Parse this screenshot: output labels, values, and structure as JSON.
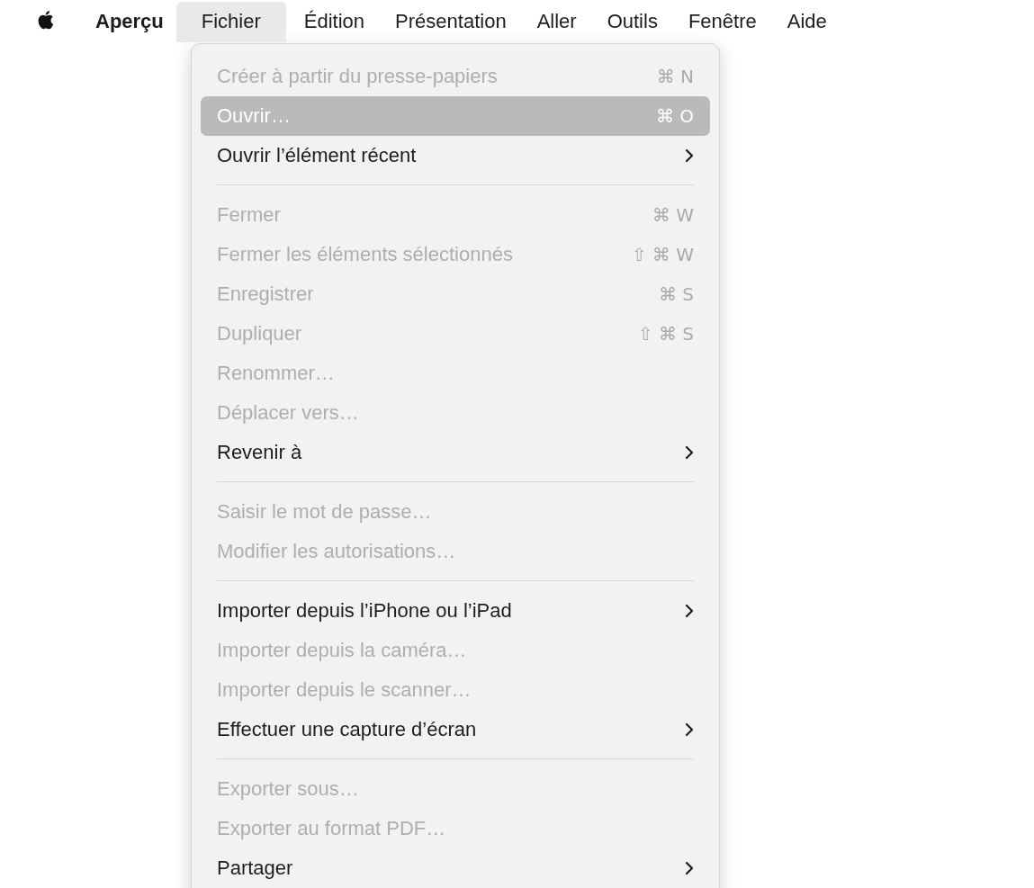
{
  "menu_bar": {
    "app_name": "Aperçu",
    "menus": [
      {
        "label": "Fichier",
        "selected": true
      },
      {
        "label": "Édition",
        "selected": false
      },
      {
        "label": "Présentation",
        "selected": false
      },
      {
        "label": "Aller",
        "selected": false
      },
      {
        "label": "Outils",
        "selected": false
      },
      {
        "label": "Fenêtre",
        "selected": false
      },
      {
        "label": "Aide",
        "selected": false
      }
    ]
  },
  "menu": {
    "items": [
      {
        "kind": "item",
        "label": "Créer à partir du presse-papiers",
        "shortcut": "⌘ N",
        "disabled": true,
        "selected": false,
        "submenu": false
      },
      {
        "kind": "item",
        "label": "Ouvrir…",
        "shortcut": "⌘ O",
        "disabled": false,
        "selected": true,
        "submenu": false
      },
      {
        "kind": "item",
        "label": "Ouvrir l’élément récent",
        "disabled": false,
        "selected": false,
        "submenu": true
      },
      {
        "kind": "separator"
      },
      {
        "kind": "item",
        "label": "Fermer",
        "shortcut": "⌘ W",
        "disabled": true,
        "selected": false,
        "submenu": false
      },
      {
        "kind": "item",
        "label": "Fermer les éléments sélectionnés",
        "shortcut": "⇧ ⌘ W",
        "disabled": true,
        "selected": false,
        "submenu": false
      },
      {
        "kind": "item",
        "label": "Enregistrer",
        "shortcut": "⌘ S",
        "disabled": true,
        "selected": false,
        "submenu": false
      },
      {
        "kind": "item",
        "label": "Dupliquer",
        "shortcut": "⇧ ⌘ S",
        "disabled": true,
        "selected": false,
        "submenu": false
      },
      {
        "kind": "item",
        "label": "Renommer…",
        "disabled": true,
        "selected": false,
        "submenu": false
      },
      {
        "kind": "item",
        "label": "Déplacer vers…",
        "disabled": true,
        "selected": false,
        "submenu": false
      },
      {
        "kind": "item",
        "label": "Revenir à",
        "disabled": false,
        "selected": false,
        "submenu": true
      },
      {
        "kind": "separator"
      },
      {
        "kind": "item",
        "label": "Saisir le mot de passe…",
        "disabled": true,
        "selected": false,
        "submenu": false
      },
      {
        "kind": "item",
        "label": "Modifier les autorisations…",
        "disabled": true,
        "selected": false,
        "submenu": false
      },
      {
        "kind": "separator"
      },
      {
        "kind": "item",
        "label": "Importer depuis l’iPhone ou l’iPad",
        "disabled": false,
        "selected": false,
        "submenu": true
      },
      {
        "kind": "item",
        "label": "Importer depuis la caméra…",
        "disabled": true,
        "selected": false,
        "submenu": false
      },
      {
        "kind": "item",
        "label": "Importer depuis le scanner…",
        "disabled": true,
        "selected": false,
        "submenu": false
      },
      {
        "kind": "item",
        "label": "Effectuer une capture d’écran",
        "disabled": false,
        "selected": false,
        "submenu": true
      },
      {
        "kind": "separator"
      },
      {
        "kind": "item",
        "label": "Exporter sous…",
        "disabled": true,
        "selected": false,
        "submenu": false
      },
      {
        "kind": "item",
        "label": "Exporter au format PDF…",
        "disabled": true,
        "selected": false,
        "submenu": false
      },
      {
        "kind": "item",
        "label": "Partager",
        "disabled": false,
        "selected": false,
        "submenu": true
      }
    ]
  }
}
